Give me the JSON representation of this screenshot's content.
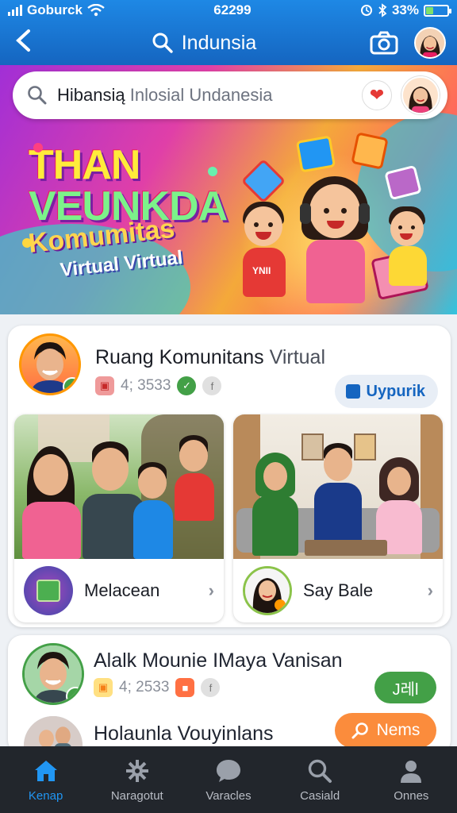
{
  "status_bar": {
    "carrier": "Goburck",
    "time": "62299",
    "battery_percent": "33%",
    "battery_level": 0.33
  },
  "header": {
    "title": "Indunsia",
    "icons": [
      "back-icon",
      "search-icon",
      "camera-icon",
      "profile-avatar"
    ]
  },
  "search": {
    "query_bold": "Hibansią",
    "query_rest": "Inlosial Undanesia"
  },
  "banner": {
    "title_line1": "THAN",
    "title_line2": "VEUNKDA",
    "title_line3": "Komumitas",
    "title_line4": "Virtual Virtual",
    "kid_shirt_text": "YNII"
  },
  "post1": {
    "name_bold": "Ruang Komunitans",
    "name_rest": "Virtual",
    "stat_value": "4; 3533",
    "follow_label": "Uypurik",
    "tiles": [
      {
        "label": "Melacean"
      },
      {
        "label": "Say Bale"
      }
    ]
  },
  "post2": {
    "name": "Alalk Mounie IMaya Vanisan",
    "stat_value": "4; 2533",
    "action_label": "J레l"
  },
  "post3": {
    "name": "Holaunla Vouyinlans",
    "action_label": "Nems"
  },
  "bottom_nav": {
    "items": [
      {
        "label": "Kenap",
        "icon": "home-icon",
        "active": true
      },
      {
        "label": "Naragotut",
        "icon": "gear-icon",
        "active": false
      },
      {
        "label": "Varacles",
        "icon": "chat-icon",
        "active": false
      },
      {
        "label": "Casiald",
        "icon": "search-icon",
        "active": false
      },
      {
        "label": "Onnes",
        "icon": "person-icon",
        "active": false
      }
    ]
  },
  "colors": {
    "header_blue": "#1e88e5",
    "active_tab": "#2196f3",
    "follow_text": "#1565c0",
    "green_button": "#43a047",
    "orange_button": "#fb8c3c",
    "bottom_nav_bg": "#22262c"
  }
}
